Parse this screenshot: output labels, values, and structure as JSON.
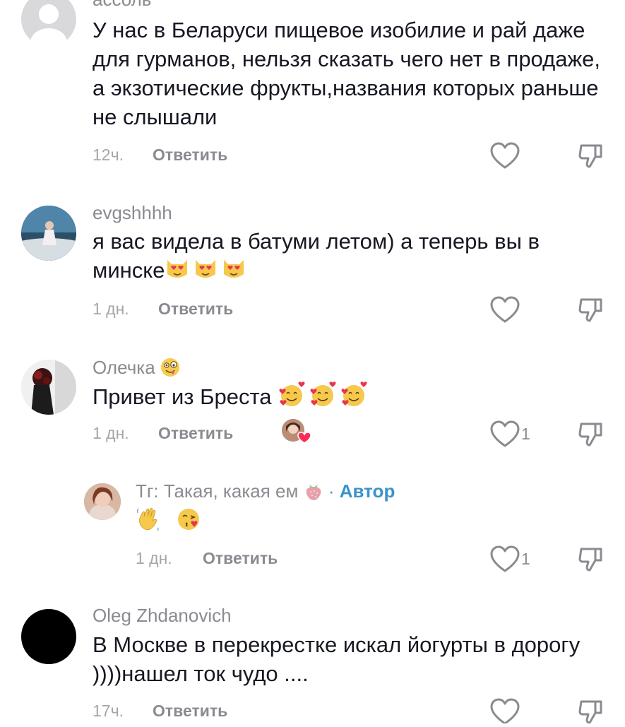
{
  "comments": [
    {
      "username": "ассоль",
      "text": "У нас в Беларуси пищевое изобилие и рай даже для гурманов, нельзя сказать чего нет в продаже, а экзотические фрукты,названия которых раньше не слышали",
      "time": "12ч.",
      "reply_label": "Ответить"
    },
    {
      "username": "evgshhhh",
      "text": "я вас видела в батуми летом) а теперь вы в минске",
      "time": "1 дн.",
      "reply_label": "Ответить"
    },
    {
      "username": "Олечка",
      "text": "Привет из Бреста",
      "time": "1 дн.",
      "reply_label": "Ответить",
      "likes": "1"
    },
    {
      "username": "Тг: Такая, какая ем",
      "separator": "·",
      "author_label": "Автор",
      "time": "1 дн.",
      "reply_label": "Ответить",
      "likes": "1"
    },
    {
      "username": "Oleg Zhdanovich",
      "text": "В Москве в перекрестке искал йогурты в дорогу ))))нашел ток чудо ....",
      "time": "17ч.",
      "reply_label": "Ответить"
    }
  ],
  "icons": {
    "like": "heart-outline-icon",
    "dislike": "thumbs-down-outline-icon"
  },
  "colors": {
    "text": "#161823",
    "muted": "#8a8b91",
    "author": "#3b93c9"
  }
}
